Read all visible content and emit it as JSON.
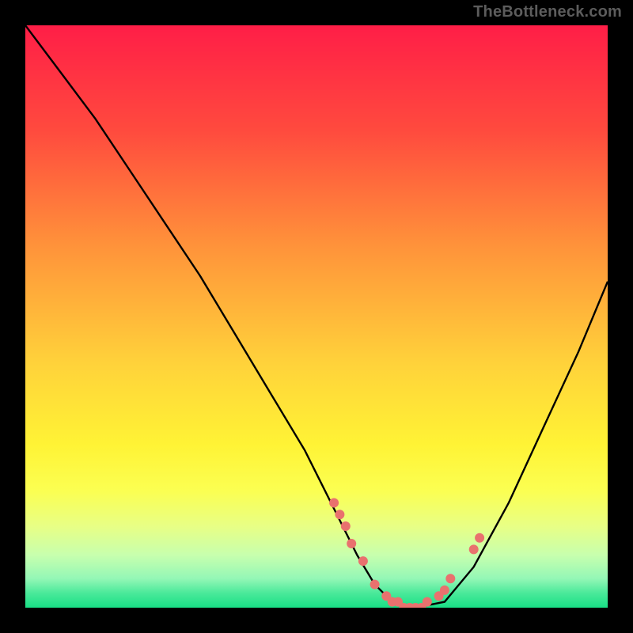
{
  "watermark": "TheBottleneck.com",
  "chart_data": {
    "type": "line",
    "title": "",
    "xlabel": "",
    "ylabel": "",
    "xlim": [
      0,
      100
    ],
    "ylim": [
      0,
      100
    ],
    "grid": false,
    "legend": "none",
    "background_gradient": {
      "type": "linear_vertical",
      "stops": [
        {
          "pos": 0.0,
          "color": "#ff1e47"
        },
        {
          "pos": 0.18,
          "color": "#ff4a3e"
        },
        {
          "pos": 0.38,
          "color": "#ff933a"
        },
        {
          "pos": 0.58,
          "color": "#ffd23a"
        },
        {
          "pos": 0.72,
          "color": "#fff335"
        },
        {
          "pos": 0.8,
          "color": "#fbff52"
        },
        {
          "pos": 0.86,
          "color": "#e8ff85"
        },
        {
          "pos": 0.91,
          "color": "#c7ffae"
        },
        {
          "pos": 0.95,
          "color": "#94f7b6"
        },
        {
          "pos": 0.975,
          "color": "#4ae99a"
        },
        {
          "pos": 1.0,
          "color": "#18df85"
        }
      ]
    },
    "series": [
      {
        "name": "bottleneck-curve",
        "color": "#000000",
        "x": [
          0,
          6,
          12,
          18,
          24,
          30,
          36,
          42,
          48,
          53,
          57,
          60,
          63,
          67,
          72,
          77,
          83,
          89,
          95,
          100
        ],
        "values": [
          100,
          92,
          84,
          75,
          66,
          57,
          47,
          37,
          27,
          17,
          9,
          4,
          1,
          0,
          1,
          7,
          18,
          31,
          44,
          56
        ]
      }
    ],
    "overlay_points": {
      "name": "highlight-dots",
      "color": "#e9716e",
      "radius": 6,
      "x": [
        53,
        54,
        55,
        56,
        58,
        60,
        62,
        63,
        64,
        65,
        66,
        67,
        68,
        69,
        71,
        72,
        73,
        77,
        78
      ],
      "values": [
        18,
        16,
        14,
        11,
        8,
        4,
        2,
        1,
        1,
        0,
        0,
        0,
        0,
        1,
        2,
        3,
        5,
        10,
        12
      ]
    }
  }
}
